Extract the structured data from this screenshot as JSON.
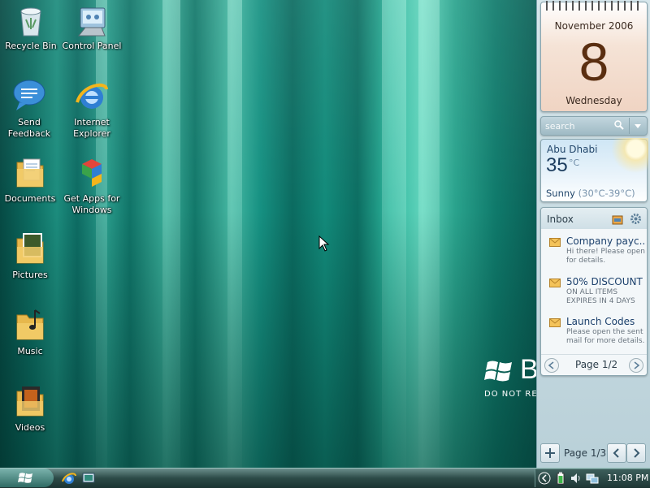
{
  "desktop": {
    "icons": [
      {
        "label": "Recycle Bin",
        "icon": "recycle-bin-icon"
      },
      {
        "label": "Control Panel",
        "icon": "control-panel-icon"
      },
      {
        "label": "Send Feedback",
        "icon": "send-feedback-icon"
      },
      {
        "label": "Internet Explorer",
        "icon": "internet-explorer-icon"
      },
      {
        "label": "Documents",
        "icon": "documents-folder-icon"
      },
      {
        "label": "Get Apps for Windows",
        "icon": "get-apps-icon"
      },
      {
        "label": "Pictures",
        "icon": "pictures-folder-icon"
      },
      {
        "label": "Music",
        "icon": "music-folder-icon"
      },
      {
        "label": "Videos",
        "icon": "videos-folder-icon"
      }
    ],
    "watermark": {
      "brand": "B",
      "subtitle": "DO NOT RE"
    }
  },
  "sidebar": {
    "calendar": {
      "month": "November 2006",
      "day": "8",
      "weekday": "Wednesday"
    },
    "search": {
      "placeholder": "search"
    },
    "weather": {
      "city": "Abu Dhabi",
      "temp": "35",
      "unit": "°C",
      "condition": "Sunny",
      "range": "(30°C-39°C)"
    },
    "inbox": {
      "title": "Inbox",
      "messages": [
        {
          "subject": "Company payc...",
          "body": "Hi there! Please open for details."
        },
        {
          "subject": "50% DISCOUNT",
          "body": "ON ALL ITEMS EXPIRES IN 4 DAYS"
        },
        {
          "subject": "Launch Codes",
          "body": "Please open the sent mail for more details."
        }
      ],
      "page": "Page 1/2"
    },
    "page": "Page 1/3"
  },
  "taskbar": {
    "clock": "11:08 PM"
  },
  "colors": {
    "accent": "#0d6a5c",
    "sidebar": "#c7dbe2"
  }
}
